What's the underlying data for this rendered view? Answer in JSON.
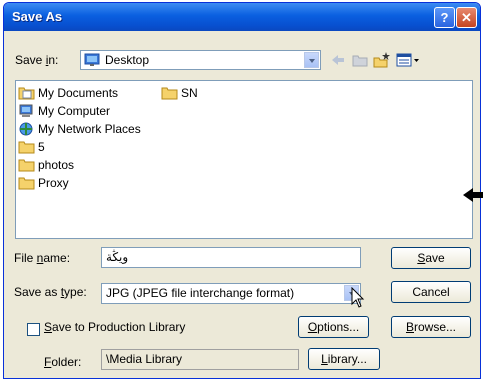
{
  "window": {
    "title": "Save As",
    "help_label": "?",
    "close_label": "✕"
  },
  "save_in": {
    "label_pre": "Save ",
    "label_key": "i",
    "label_post": "n:",
    "value": "Desktop"
  },
  "files": [
    {
      "name": "My Documents",
      "icon": "my-documents-icon"
    },
    {
      "name": "SN",
      "icon": "folder-icon"
    },
    {
      "name": "My Computer",
      "icon": "computer-icon"
    },
    {
      "name": "My Network Places",
      "icon": "network-icon"
    },
    {
      "name": "5",
      "icon": "folder-icon"
    },
    {
      "name": "photos",
      "icon": "folder-icon"
    },
    {
      "name": "Proxy",
      "icon": "folder-icon"
    }
  ],
  "file_name": {
    "label_pre": "File ",
    "label_key": "n",
    "label_post": "ame:",
    "value": "ويڭة"
  },
  "save_as_type": {
    "label_pre": "Save as ",
    "label_key": "t",
    "label_post": "ype:",
    "value": "JPG (JPEG file interchange format)"
  },
  "buttons": {
    "save_key": "S",
    "save_rest": "ave",
    "cancel": "Cancel",
    "options_key": "O",
    "options_rest": "ptions...",
    "browse_key": "B",
    "browse_rest": "rowse...",
    "library_key": "L",
    "library_rest": "ibrary..."
  },
  "production": {
    "label_key": "S",
    "label_rest": "ave to Production Library"
  },
  "folder": {
    "label_key": "F",
    "label_rest": "older:",
    "value": "\\Media Library"
  },
  "colors": {
    "title_bar": "#0a5fe0",
    "dialog_bg": "#ece9d8",
    "folder": "#f5d26b"
  }
}
